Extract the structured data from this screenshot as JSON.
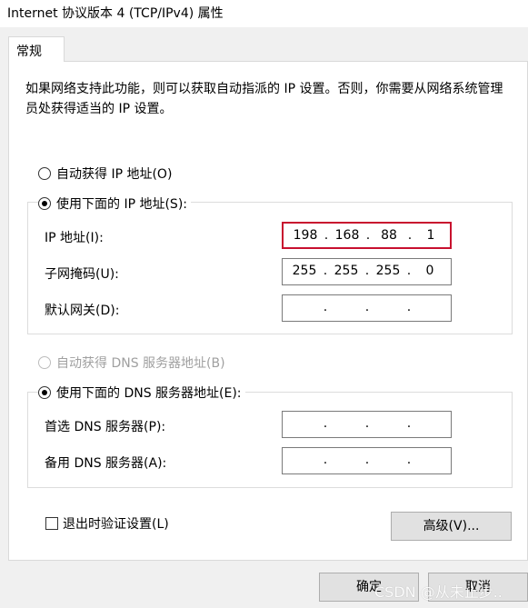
{
  "window": {
    "title": "Internet 协议版本 4 (TCP/IPv4) 属性"
  },
  "tabs": [
    {
      "label": "常规"
    }
  ],
  "description": "如果网络支持此功能，则可以获取自动指派的 IP 设置。否则，你需要从网络系统管理员处获得适当的 IP 设置。",
  "ip_section": {
    "auto_label": "自动获得 IP 地址(O)",
    "auto_selected": false,
    "manual_label": "使用下面的 IP 地址(S):",
    "manual_selected": true,
    "fields": [
      {
        "label": "IP 地址(I):",
        "octets": [
          "198",
          "168",
          "88",
          "1"
        ],
        "focused": true
      },
      {
        "label": "子网掩码(U):",
        "octets": [
          "255",
          "255",
          "255",
          "0"
        ],
        "focused": false
      },
      {
        "label": "默认网关(D):",
        "octets": [
          "",
          "",
          "",
          ""
        ],
        "focused": false
      }
    ]
  },
  "dns_section": {
    "auto_label": "自动获得 DNS 服务器地址(B)",
    "auto_disabled": true,
    "manual_label": "使用下面的 DNS 服务器地址(E):",
    "manual_selected": true,
    "fields": [
      {
        "label": "首选 DNS 服务器(P):",
        "octets": [
          "",
          "",
          "",
          ""
        ]
      },
      {
        "label": "备用 DNS 服务器(A):",
        "octets": [
          "",
          "",
          "",
          ""
        ]
      }
    ]
  },
  "validate_label": "退出时验证设置(L)",
  "validate_checked": false,
  "advanced_button": "高级(V)...",
  "ok_button": "确定",
  "cancel_button": "取消",
  "watermark": "CSDN @从未止步.."
}
